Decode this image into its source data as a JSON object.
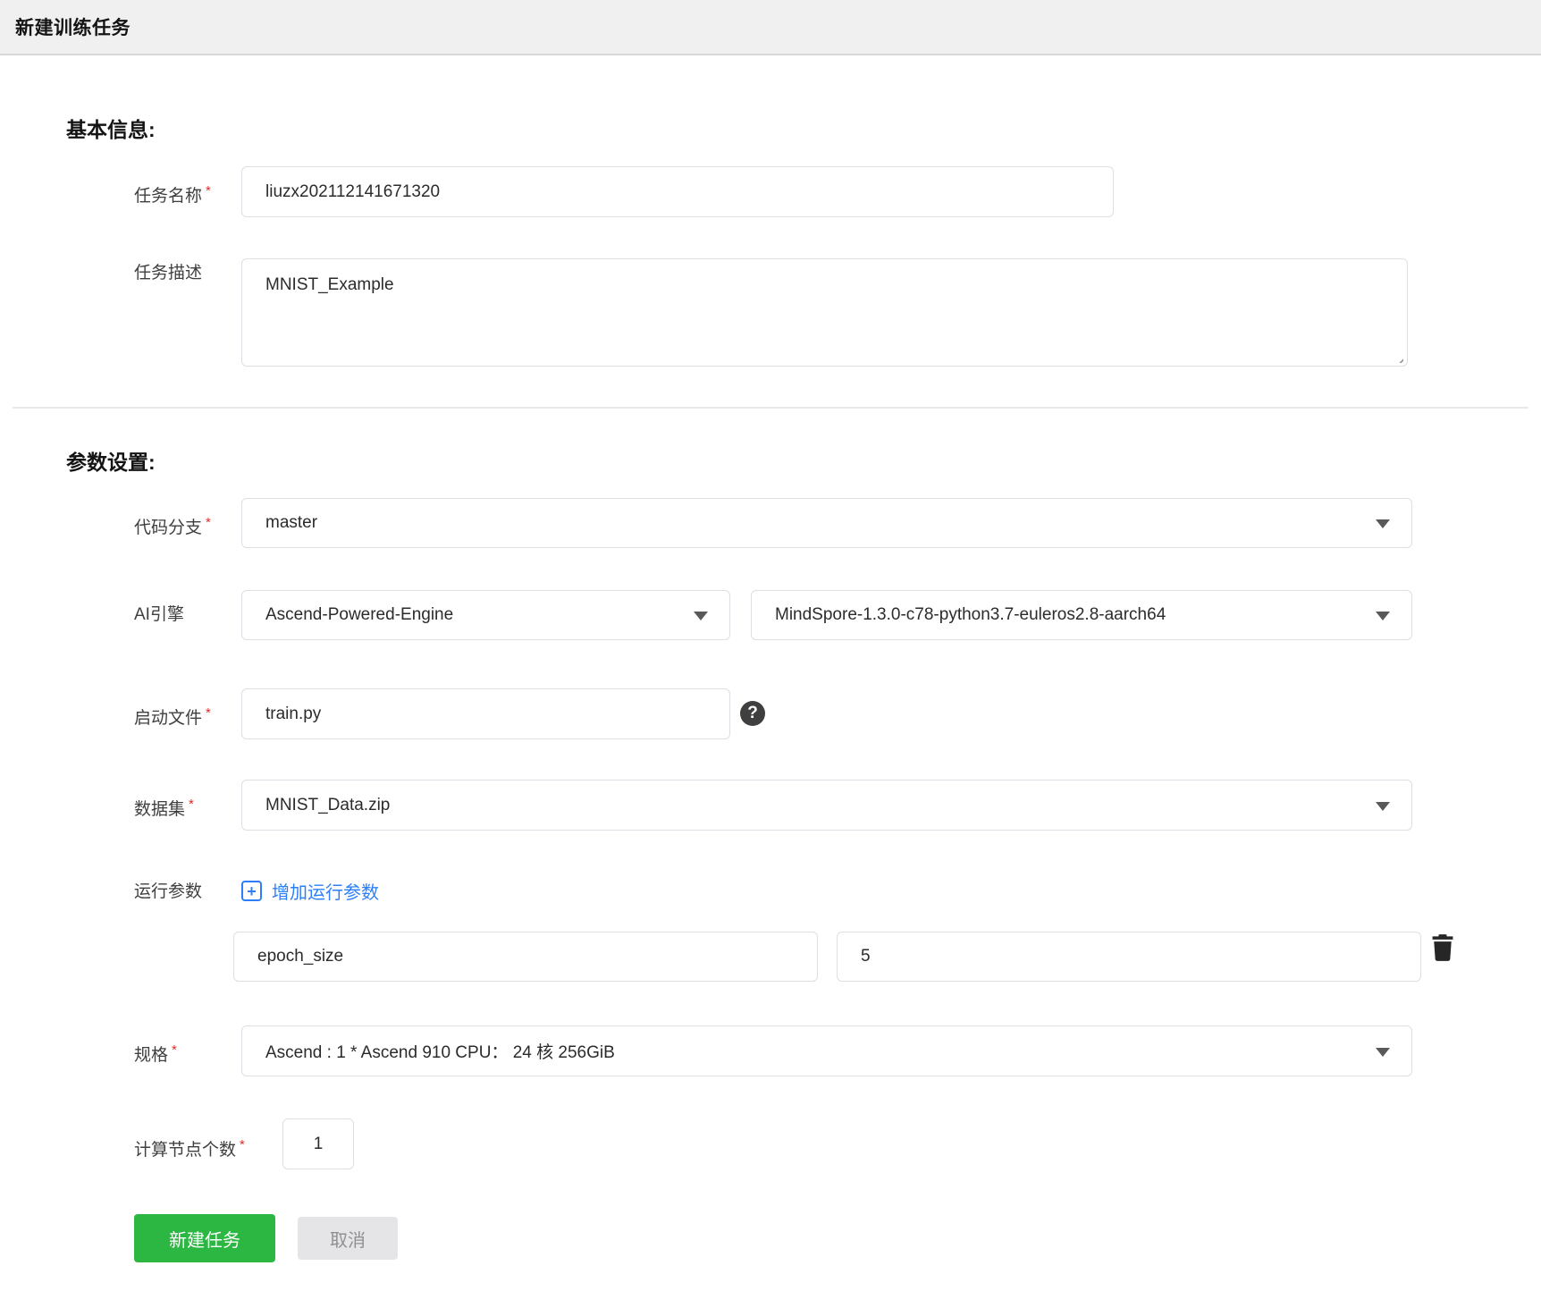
{
  "header": {
    "title": "新建训练任务"
  },
  "sections": {
    "basic_heading": "基本信息:",
    "params_heading": "参数设置:"
  },
  "fields": {
    "task_name": {
      "label": "任务名称",
      "required": true,
      "value": "liuzx202112141671320"
    },
    "task_desc": {
      "label": "任务描述",
      "required": false,
      "value": "MNIST_Example"
    },
    "code_branch": {
      "label": "代码分支",
      "required": true,
      "value": "master"
    },
    "ai_engine": {
      "label": "AI引擎",
      "engine": "Ascend-Powered-Engine",
      "version": "MindSpore-1.3.0-c78-python3.7-euleros2.8-aarch64"
    },
    "boot_file": {
      "label": "启动文件",
      "required": true,
      "value": "train.py"
    },
    "dataset": {
      "label": "数据集",
      "required": true,
      "value": "MNIST_Data.zip"
    },
    "run_params": {
      "label": "运行参数",
      "add_label": "增加运行参数",
      "rows": [
        {
          "key": "epoch_size",
          "value": "5"
        }
      ]
    },
    "spec": {
      "label": "规格",
      "required": true,
      "value": "Ascend : 1 * Ascend 910 CPU： 24 核 256GiB"
    },
    "node_count": {
      "label": "计算节点个数",
      "required": true,
      "value": "1"
    }
  },
  "buttons": {
    "create": "新建任务",
    "cancel": "取消"
  },
  "icons": {
    "help_glyph": "?",
    "add_glyph": "+"
  },
  "misc": {
    "required_mark": "*"
  },
  "colors": {
    "accent_green": "#2bb742",
    "link_blue": "#2d7ff9",
    "required_red": "#e02b2b",
    "topbar_gray": "#f0f0f0",
    "border_gray": "#dcdfe3"
  }
}
